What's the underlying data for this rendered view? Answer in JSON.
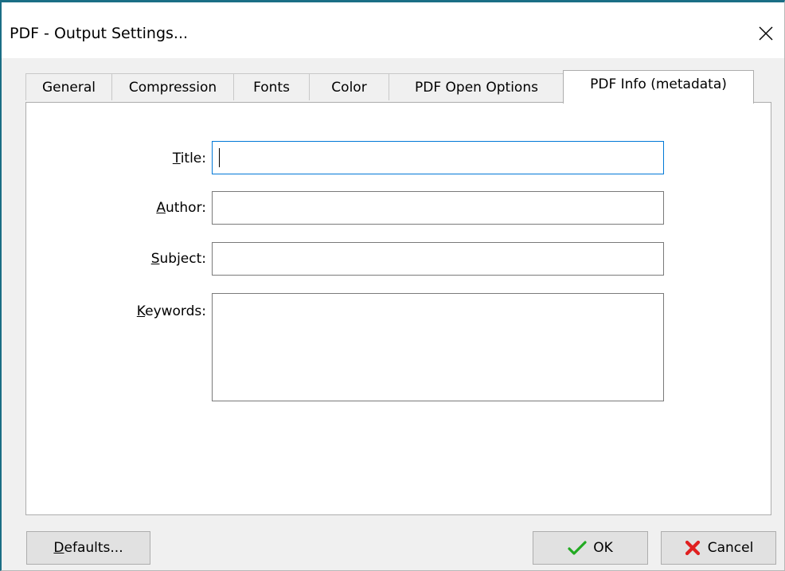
{
  "window": {
    "title": "PDF - Output Settings...",
    "close_glyph": "✕",
    "accent_color": "#1a6e85",
    "focus_color": "#0078d7"
  },
  "tabs": [
    {
      "label": "General",
      "active": false
    },
    {
      "label": "Compression",
      "active": false
    },
    {
      "label": "Fonts",
      "active": false
    },
    {
      "label": "Color",
      "active": false
    },
    {
      "label": "PDF Open Options",
      "active": false
    },
    {
      "label": "PDF Info (metadata)",
      "active": true
    }
  ],
  "form": {
    "title": {
      "label": "Title:",
      "value": ""
    },
    "author": {
      "label": "Author:",
      "value": ""
    },
    "subject": {
      "label": "Subject:",
      "value": ""
    },
    "keywords": {
      "label": "Keywords:",
      "value": ""
    }
  },
  "buttons": {
    "defaults": {
      "label": "Defaults..."
    },
    "ok": {
      "label": "OK",
      "icon": "checkmark-icon",
      "icon_color": "#22aa22"
    },
    "cancel": {
      "label": "Cancel",
      "icon": "red-x-icon",
      "icon_color": "#e02020"
    }
  }
}
